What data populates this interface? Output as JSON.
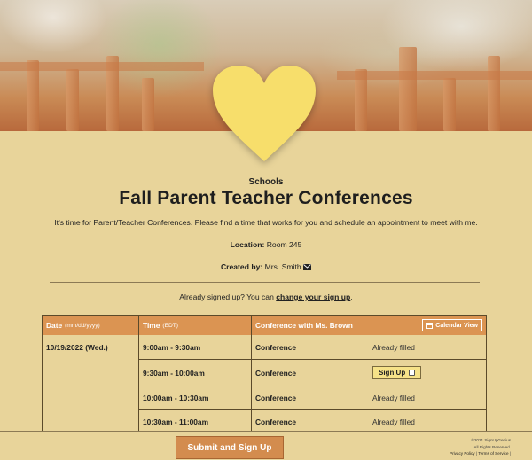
{
  "header": {
    "category": "Schools",
    "title": "Fall Parent Teacher Conferences",
    "intro": "It's time for Parent/Teacher Conferences. Please find a time that works for you and schedule an appointment to meet with me.",
    "location_label": "Location:",
    "location_value": "Room 245",
    "created_label": "Created by:",
    "created_value": "Mrs. Smith"
  },
  "signed_up": {
    "prefix": "Already signed up? You can",
    "link": "change your sign up",
    "suffix": "."
  },
  "table": {
    "col_date": "Date",
    "col_date_sub": "(mm/dd/yyyy)",
    "col_time": "Time",
    "col_time_sub": "(EDT)",
    "col_slot": "Conference with Ms. Brown",
    "calendar_view": "Calendar View",
    "date": "10/19/2022 (Wed.)",
    "rows": [
      {
        "time": "9:00am - 9:30am",
        "slot": "Conference",
        "status": "Already filled"
      },
      {
        "time": "9:30am - 10:00am",
        "slot": "Conference",
        "status": "Sign Up"
      },
      {
        "time": "10:00am - 10:30am",
        "slot": "Conference",
        "status": "Already filled"
      },
      {
        "time": "10:30am - 11:00am",
        "slot": "Conference",
        "status": "Already filled"
      }
    ]
  },
  "footer": {
    "submit": "Submit and Sign Up",
    "copyright": "©2021 SignUpGenius",
    "rights": "All Rights Reserved.",
    "privacy": "Privacy Policy",
    "separator": "|",
    "terms": "Terms of Service",
    "separator2": "|"
  },
  "icons": {
    "heart": "heart-icon",
    "email": "envelope-icon",
    "calendar": "calendar-icon",
    "checkbox": "checkbox-icon"
  },
  "colors": {
    "page_bg": "#e8d49a",
    "header_orange": "#db9452",
    "heart_yellow": "#f7de6b",
    "signup_bg": "#f6e288",
    "submit_bg": "#d38c4e"
  }
}
